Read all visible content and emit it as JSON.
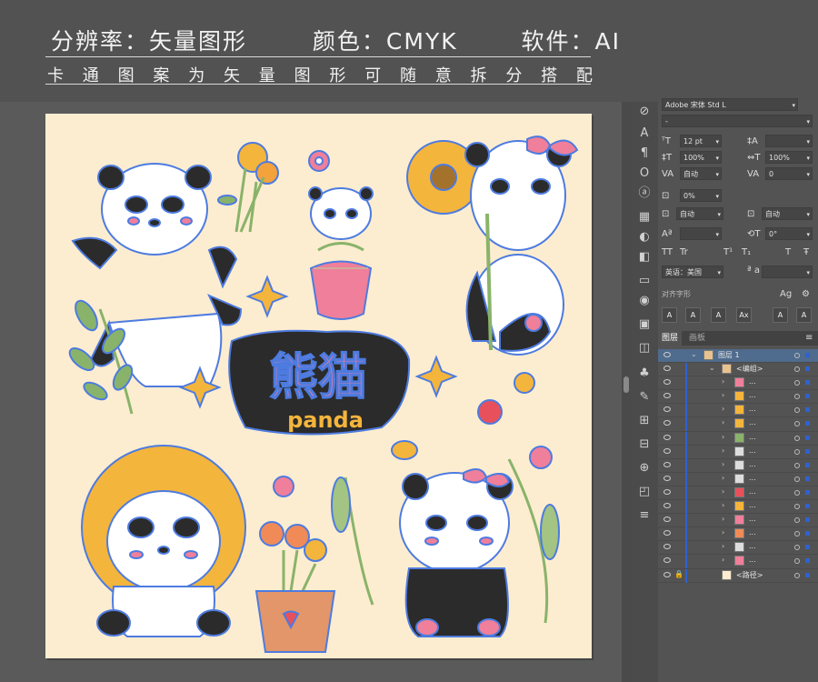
{
  "banner": {
    "spec_resolution": "分辨率：矢量图形",
    "spec_color": "颜色：CMYK",
    "spec_software": "软件：AI",
    "subtitle_chars": [
      "卡",
      "通",
      "图",
      "案",
      "为",
      "矢",
      "量",
      "图",
      "形",
      "可",
      "随",
      "意",
      "拆",
      "分",
      "搭",
      "配"
    ]
  },
  "artwork": {
    "title_cn": "熊猫",
    "title_en": "panda"
  },
  "character_panel": {
    "font_family": "Adobe 宋体 Std L",
    "font_style": "-",
    "font_size": "12 pt",
    "leading": "",
    "vertical_scale": "100%",
    "horizontal_scale": "100%",
    "kerning": "自动",
    "tracking": "0",
    "tsume": "0%",
    "aki_left": "自动",
    "aki_right": "自动",
    "baseline_shift": "",
    "rotation": "0°",
    "tt_buttons": [
      "TT",
      "Tr",
      "T¹",
      "T₁",
      "T",
      "Ŧ"
    ],
    "language": "英语：美国",
    "antialias_label": "ª a",
    "glyph_section_label": "对齐字形",
    "glyph_buttons": [
      "A",
      "A",
      "A",
      "Ax",
      "A",
      "A"
    ]
  },
  "layers_panel": {
    "tab_layers": "图层",
    "tab_artboards": "画板",
    "layer_name": "图层 1",
    "group_name": "<编组>",
    "sublayer_label": "...",
    "path_name": "<路径>",
    "sublayer_count": 14
  },
  "colors": {
    "artboard_bg": "#fdedd0",
    "path_blue": "#4d7be0",
    "panda_black": "#2b2b2b",
    "sunflower": "#f4b53c",
    "pink": "#ef7f9a",
    "leaf": "#89b36a"
  }
}
